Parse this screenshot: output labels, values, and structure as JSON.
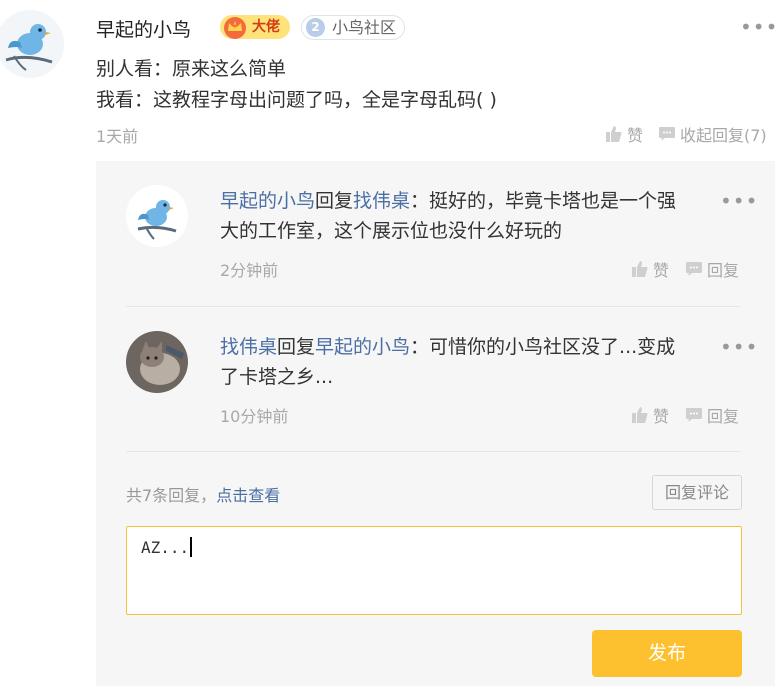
{
  "post": {
    "author": "早起的小鸟",
    "badge_title": "大佬",
    "community_level": "2",
    "community_name": "小鸟社区",
    "more": "•••",
    "line1": "别人看：原来这么简单",
    "line2": "我看：这教程字母出问题了吗，全是字母乱码(   )",
    "time": "1天前",
    "like_label": "赞",
    "collapse_label": "收起回复(7)"
  },
  "replies": [
    {
      "from": "早起的小鸟",
      "verb": "回复",
      "to": "找伟桌",
      "text": "：挺好的，毕竟卡塔也是一个强大的工作室，这个展示位也没什么好玩的",
      "time": "2分钟前",
      "like_label": "赞",
      "reply_label": "回复",
      "more": "•••"
    },
    {
      "from": "找伟桌",
      "verb": "回复",
      "to": "早起的小鸟",
      "text": "：可惜你的小鸟社区没了...变成了卡塔之乡...",
      "time": "10分钟前",
      "like_label": "赞",
      "reply_label": "回复",
      "more": "•••"
    }
  ],
  "footer": {
    "total_prefix": "共7条回复，",
    "view_link": "点击查看",
    "reply_comment_button": "回复评论",
    "input_value": "AZ...",
    "publish_button": "发布"
  },
  "colors": {
    "link": "#4a6fa5",
    "publish": "#fdc02f",
    "badge": "#fde37a",
    "input_border": "#f3c140"
  },
  "icons": [
    "bird-avatar-icon",
    "crown-icon",
    "thumb-up-icon",
    "comment-icon",
    "more-icon",
    "cat-avatar-icon"
  ]
}
